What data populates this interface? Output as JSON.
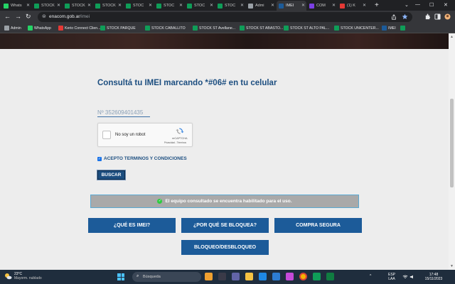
{
  "tabs": [
    {
      "label": "Whats",
      "color": "#25d366"
    },
    {
      "label": "STOCK",
      "color": "#0f9d58"
    },
    {
      "label": "STOCK",
      "color": "#0f9d58"
    },
    {
      "label": "STOCK",
      "color": "#0f9d58"
    },
    {
      "label": "STOC",
      "color": "#0f9d58"
    },
    {
      "label": "STOC",
      "color": "#0f9d58"
    },
    {
      "label": "STOC",
      "color": "#0f9d58"
    },
    {
      "label": "STOC",
      "color": "#0f9d58"
    },
    {
      "label": "Admi",
      "color": "#9aa0a6"
    },
    {
      "label": "IMEI",
      "color": "#1c5b99"
    },
    {
      "label": "COM",
      "color": "#7b3fe4"
    },
    {
      "label": "(1) K",
      "color": "#e53935"
    }
  ],
  "browser": {
    "url_domain": "enacom.gob.ar",
    "url_path": "/imei",
    "back": "←",
    "forward": "→",
    "reload": "↻",
    "lock": "⊜",
    "new_tab": "+",
    "minimize": "—",
    "maximize": "☐",
    "close": "✕",
    "chevron": "⌄"
  },
  "bookmarks": [
    {
      "label": "Admin",
      "color": "#9aa0a6"
    },
    {
      "label": "WhatsApp",
      "color": "#25d366"
    },
    {
      "label": "Kerio Connect Clien...",
      "color": "#e53935"
    },
    {
      "label": "STOCK PARQUE",
      "color": "#0f9d58"
    },
    {
      "label": "STOCK CABALLITO",
      "color": "#0f9d58"
    },
    {
      "label": "STOCK ST Avellane...",
      "color": "#0f9d58"
    },
    {
      "label": "STOCK ST ABASTO...",
      "color": "#0f9d58"
    },
    {
      "label": "STOCK ST ALTO PAL...",
      "color": "#0f9d58"
    },
    {
      "label": "STOCK UNICENTER...",
      "color": "#0f9d58"
    },
    {
      "label": "IMEI",
      "color": "#1c5b99"
    }
  ],
  "page": {
    "heading": "Consultá tu IMEI marcando *#06# en tu celular",
    "imei_value": "Nº 352609401435",
    "captcha": {
      "label": "No soy un robot",
      "brand": "reCAPTCHA",
      "terms": "Privacidad - Términos"
    },
    "terms_checked_mark": "✓",
    "terms_label": "ACEPTO TERMINOS Y CONDICIONES",
    "buscar": "BUSCAR",
    "alert_icon": "✓",
    "alert_message": "El equipo consultado se encuentra habilitado para el uso.",
    "nav": {
      "que_es": "¿QUÉ ES IMEI?",
      "por_que": "¿POR QUÉ SE BLOQUEA?",
      "compra": "COMPRA SEGURA",
      "bloqueo": "BLOQUEO/DESBLOQUEO"
    }
  },
  "scrollbar": {
    "up": "▲",
    "down": "▼"
  },
  "taskbar": {
    "temp": "23°C",
    "weather": "Mayorm. nublado",
    "search_placeholder": "Búsqueda",
    "search_icon": "⌕",
    "lang": "ESP",
    "lang2": "LAA",
    "time": "17:48",
    "date": "15/11/2023",
    "tray_arrow": "^"
  }
}
